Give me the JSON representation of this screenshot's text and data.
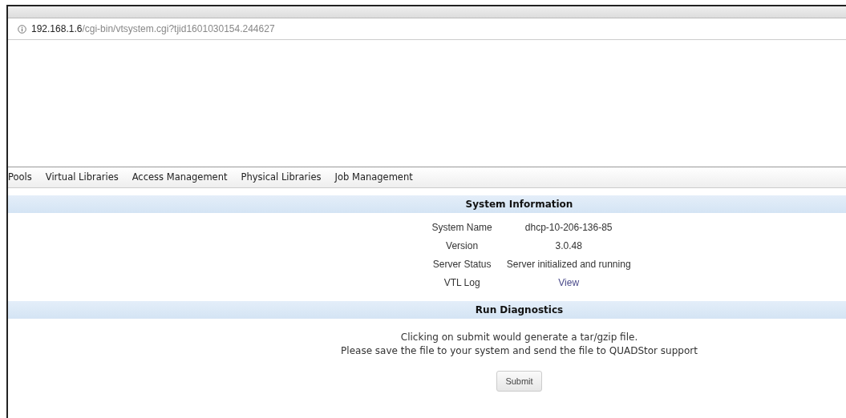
{
  "address_bar": {
    "host": "192.168.1.6",
    "path": "/cgi-bin/vtsystem.cgi?tjid1601030154.244627"
  },
  "nav": [
    {
      "label": "Pools"
    },
    {
      "label": "Virtual Libraries"
    },
    {
      "label": "Access Management"
    },
    {
      "label": "Physical Libraries"
    },
    {
      "label": "Job Management"
    }
  ],
  "system_information": {
    "title": "System Information",
    "rows": [
      {
        "label": "System Name",
        "value": "dhcp-10-206-136-85",
        "kind": "text"
      },
      {
        "label": "Version",
        "value": "3.0.48",
        "kind": "text"
      },
      {
        "label": "Server Status",
        "value": "Server initialized and running",
        "kind": "text"
      },
      {
        "label": "VTL Log",
        "value": "View",
        "kind": "link"
      }
    ]
  },
  "run_diagnostics": {
    "title": "Run Diagnostics",
    "lines": [
      "Clicking on submit would generate a tar/gzip file.",
      "Please save the file to your system and send the file to QUADStor support"
    ],
    "button": "Submit"
  }
}
